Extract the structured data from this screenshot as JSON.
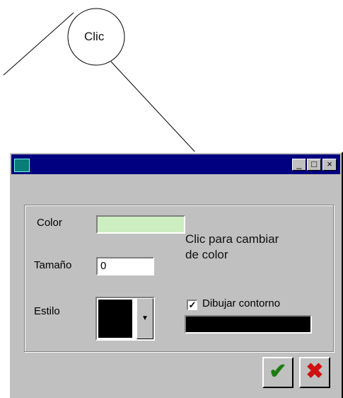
{
  "annotations": {
    "click_bubble": "Clic",
    "color_hint": "Clic para cambiar de color",
    "color_hint_line1": "Clic para cambiar",
    "color_hint_line2": "de color"
  },
  "window": {
    "title": "",
    "buttons": {
      "minimize": "_",
      "maximize": "□",
      "close": "×"
    }
  },
  "form": {
    "color_label": "Color",
    "color_value": "#cdeec0",
    "size_label": "Tamaño",
    "size_value": "0",
    "style_label": "Estilo",
    "outline_label": "Dibujar contorno",
    "outline_checked": true,
    "outline_color": "#000000"
  },
  "actions": {
    "ok_icon": "checkmark-icon",
    "cancel_icon": "x-icon"
  }
}
